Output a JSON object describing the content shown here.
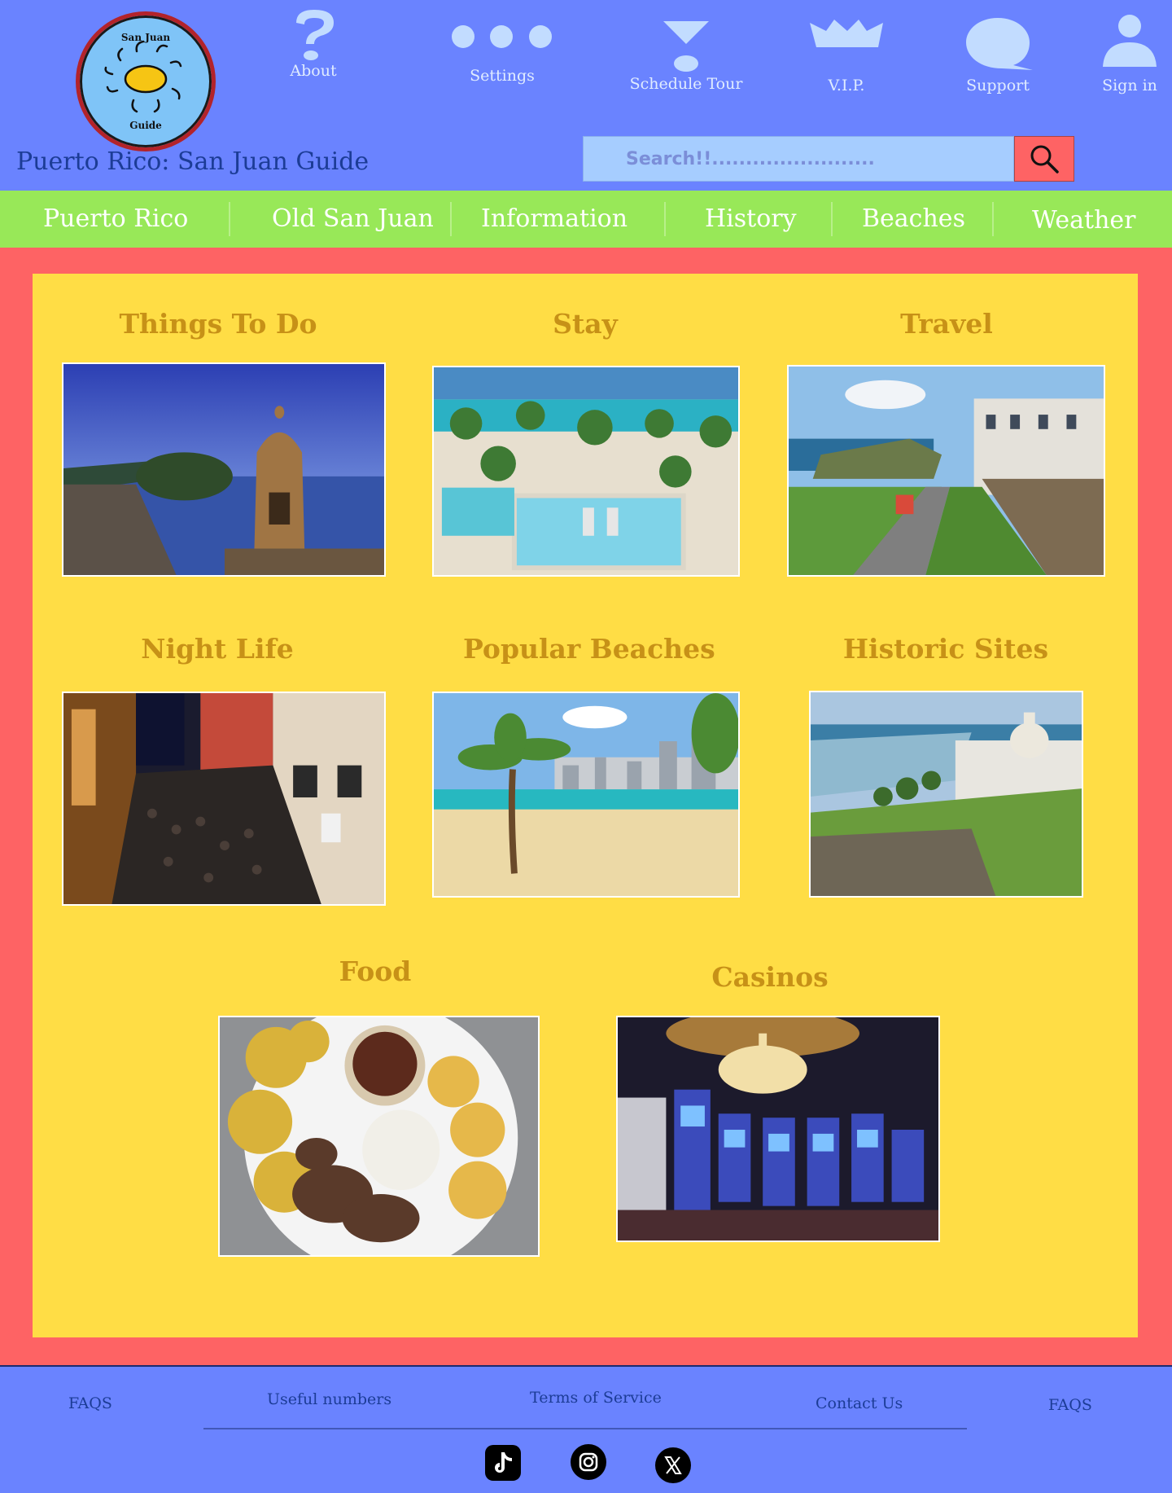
{
  "header": {
    "logo_top": "San Juan",
    "logo_bottom": "Guide",
    "site_title": "Puerto Rico: San Juan Guide",
    "icons": [
      {
        "label": "About",
        "icon": "question-icon"
      },
      {
        "label": "Settings",
        "icon": "dots-icon"
      },
      {
        "label": "Schedule Tour",
        "icon": "tour-icon"
      },
      {
        "label": "V.I.P.",
        "icon": "crown-icon"
      },
      {
        "label": "Support",
        "icon": "chat-bubble-icon"
      },
      {
        "label": "Sign in",
        "icon": "user-icon"
      }
    ],
    "search_placeholder": "Search!!........................"
  },
  "nav": {
    "items": [
      "Puerto Rico",
      "Old San Juan",
      "Information",
      "History",
      "Beaches",
      "Weather"
    ]
  },
  "cards": [
    {
      "title": "Things To Do",
      "image": "sentry-box-sunset"
    },
    {
      "title": "Stay",
      "image": "beach-resort-pool"
    },
    {
      "title": "Travel",
      "image": "coastal-road"
    },
    {
      "title": "Night Life",
      "image": "crowded-street-night"
    },
    {
      "title": "Popular Beaches",
      "image": "palm-beach"
    },
    {
      "title": "Historic Sites",
      "image": "capitol-coast"
    },
    {
      "title": "Food",
      "image": "plate-of-food"
    },
    {
      "title": "Casinos",
      "image": "casino-floor"
    }
  ],
  "footer": {
    "links": [
      "FAQS",
      "Useful numbers",
      "Terms of Service",
      "Contact Us",
      "FAQS"
    ],
    "social": [
      "tiktok-icon",
      "instagram-icon",
      "x-icon"
    ]
  },
  "colors": {
    "header_bg": "#6a83ff",
    "nav_bg": "#98e858",
    "page_bg": "#fe6364",
    "panel_bg": "#ffdd45",
    "title_gold": "#c79117"
  }
}
